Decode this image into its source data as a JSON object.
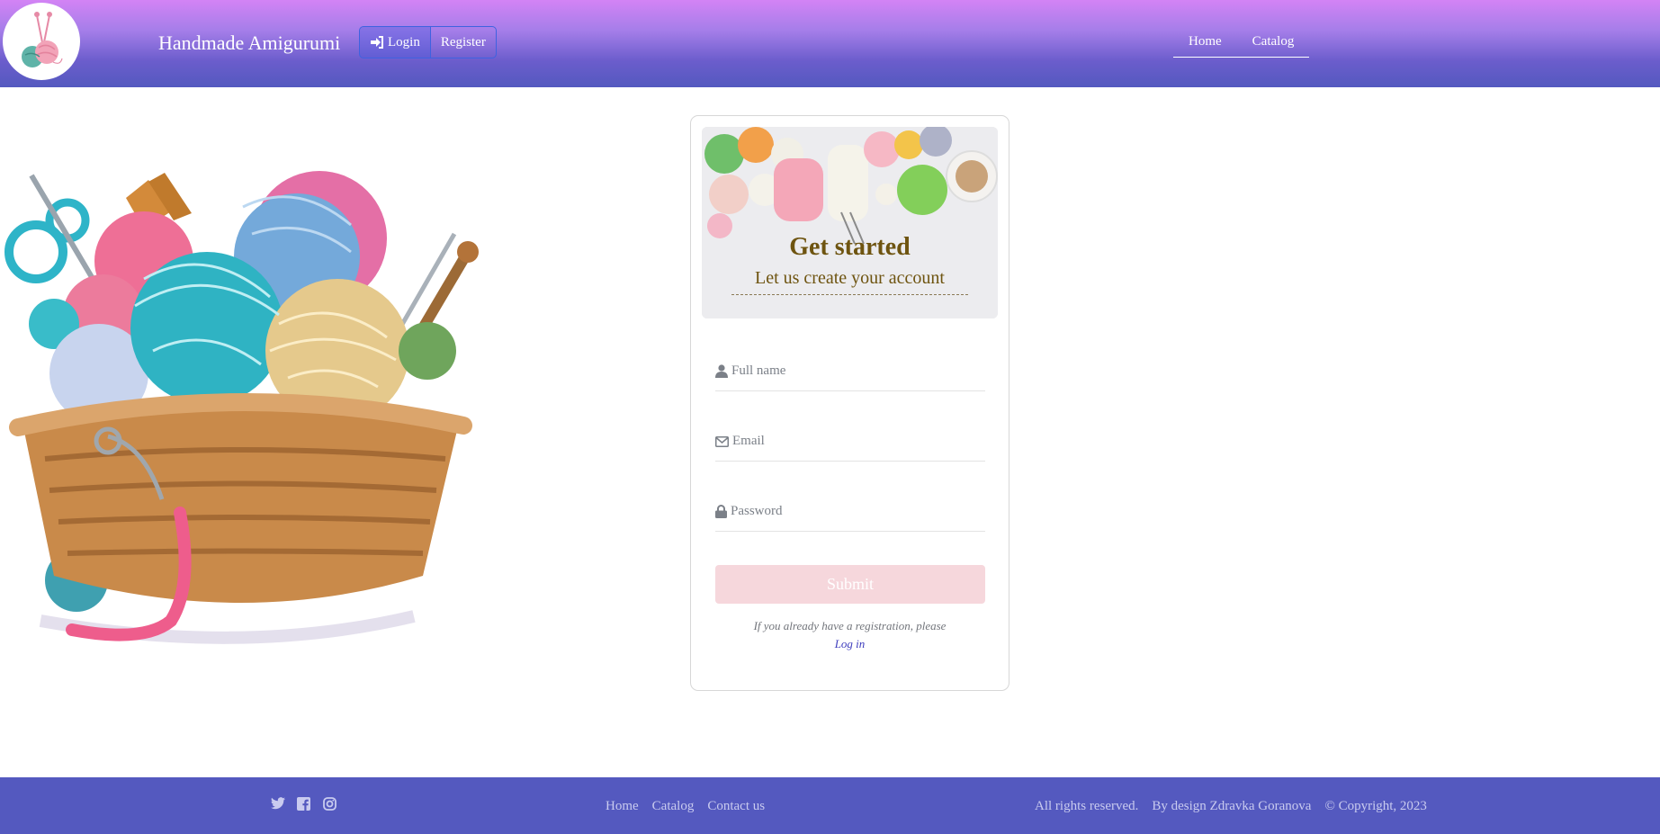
{
  "header": {
    "brand": "Handmade Amigurumi",
    "auth": {
      "login_label": "Login",
      "register_label": "Register"
    },
    "nav": [
      {
        "label": "Home"
      },
      {
        "label": "Catalog"
      }
    ],
    "colors": {
      "gradient_top": "#d383f5",
      "gradient_bottom": "#5459bf"
    }
  },
  "card": {
    "title": "Get started",
    "subtitle": "Let us create your account",
    "fields": [
      {
        "placeholder": "Full name",
        "icon": "user-icon"
      },
      {
        "placeholder": "Email",
        "icon": "envelope-icon"
      },
      {
        "placeholder": "Password",
        "icon": "lock-icon"
      }
    ],
    "submit_label": "Submit",
    "note": "If you already have a registration, please",
    "login_link": "Log in"
  },
  "footer": {
    "social": [
      "twitter-icon",
      "facebook-icon",
      "instagram-icon"
    ],
    "links": [
      {
        "label": "Home"
      },
      {
        "label": "Catalog"
      },
      {
        "label": "Contact us"
      }
    ],
    "rights": "All rights reserved.",
    "author": "By design Zdravka Goranova",
    "copyright": "© Copyright, 2023"
  }
}
